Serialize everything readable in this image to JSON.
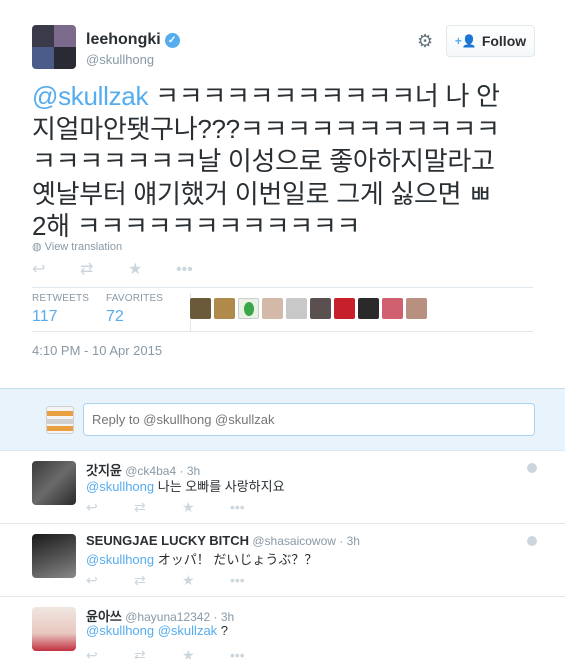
{
  "tweet": {
    "author_name": "leehongki",
    "author_handle": "@skullhong",
    "verified_icon": "verified-badge-icon",
    "follow_label": "Follow",
    "mention": "@skullzak",
    "text_lines": [
      " ㅋㅋㅋㅋㅋㅋㅋㅋㅋㅋㅋ너 나 안",
      "지얼마안됏구나???ㅋㅋㅋㅋㅋㅋㅋㅋㅋㅋㅋ",
      "ㅋㅋㅋㅋㅋㅋㅋ날 이성으로 좋아하지말라고",
      "옛날부터 얘기했거 이번일로 그게 싫으면 ㅃ",
      "2해 ㅋㅋㅋㅋㅋㅋㅋㅋㅋㅋㅋㅋ"
    ],
    "view_translation": "View translation",
    "retweets_label": "RETWEETS",
    "retweets_count": "117",
    "favorites_label": "FAVORITES",
    "favorites_count": "72",
    "timestamp": "4:10 PM - 10 Apr 2015"
  },
  "reply_box": {
    "placeholder": "Reply to @skullhong @skullzak"
  },
  "replies": [
    {
      "name": "갓지윤",
      "handle": "@ck4ba4",
      "time": "3h",
      "mention": "@skullhong",
      "text": " 나는 오빠를 사랑하지요"
    },
    {
      "name": "SEUNGJAE LUCKY BITCH",
      "handle": "@shasaicowow",
      "time": "3h",
      "mention": "@skullhong",
      "text": " オッパ！ だいじょうぶ？？"
    },
    {
      "name": "윤아쓰",
      "handle": "@hayuna12342",
      "time": "3h",
      "mention": "@skullhong @skullzak",
      "text": " ?"
    }
  ],
  "colors": {
    "accent": "#55acee",
    "muted": "#8899a6",
    "text": "#292f33"
  }
}
